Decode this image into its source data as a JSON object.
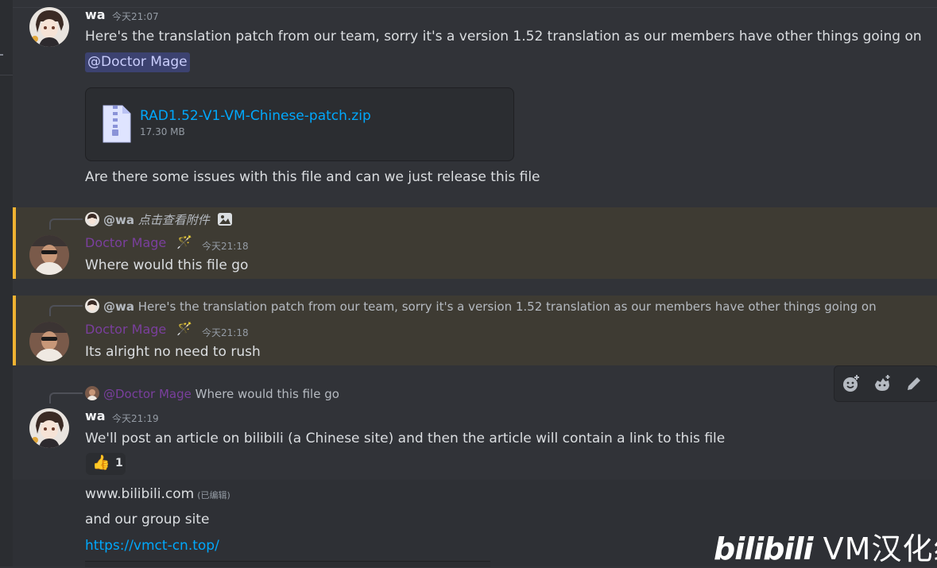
{
  "messages": {
    "m1": {
      "author": "wa",
      "timestamp": "今天21:07",
      "text": "Here's the translation patch from our team, sorry it's a version 1.52 translation as our members have other things going on",
      "mention": "@Doctor Mage",
      "attachment": {
        "name": "RAD1.52-V1-VM-Chinese-patch.zip",
        "size": "17.30 MB"
      },
      "followup": "Are there some issues with this file and can we just release this file"
    },
    "m2": {
      "reply_author": "@wa",
      "reply_text": "点击查看附件",
      "author": "Doctor Mage",
      "badge": "🪄",
      "timestamp": "今天21:18",
      "text": "Where would this file go"
    },
    "m3": {
      "reply_author": "@wa",
      "reply_text": "Here's the translation patch from our team, sorry it's a version 1.52 translation as our members have other things going on",
      "author": "Doctor Mage",
      "badge": "🪄",
      "timestamp": "今天21:18",
      "text": "Its alright no need to rush"
    },
    "m4": {
      "reply_author": "@Doctor Mage",
      "reply_text": "Where would this file go",
      "author": "wa",
      "timestamp": "今天21:19",
      "text": "We'll post an article on bilibili (a Chinese site) and then the article will contain a link to this file",
      "reaction": {
        "emoji": "👍",
        "count": "1"
      },
      "line1": "www.bilibili.com",
      "edited": "(已编辑)",
      "line2": "and our group site",
      "link": "https://vmct-cn.top/"
    }
  },
  "toolbar": {
    "icons": [
      "add-reaction-icon",
      "super-reaction-icon",
      "edit-icon"
    ]
  },
  "watermark": {
    "brand": "bilibili",
    "group": "VM汉化组"
  },
  "colors": {
    "background": "#313338",
    "highlight": "#3e3b33",
    "highlight_bar": "#f0b232",
    "link": "#00a8fc",
    "doctor_mage_name": "#7a3f9d"
  }
}
